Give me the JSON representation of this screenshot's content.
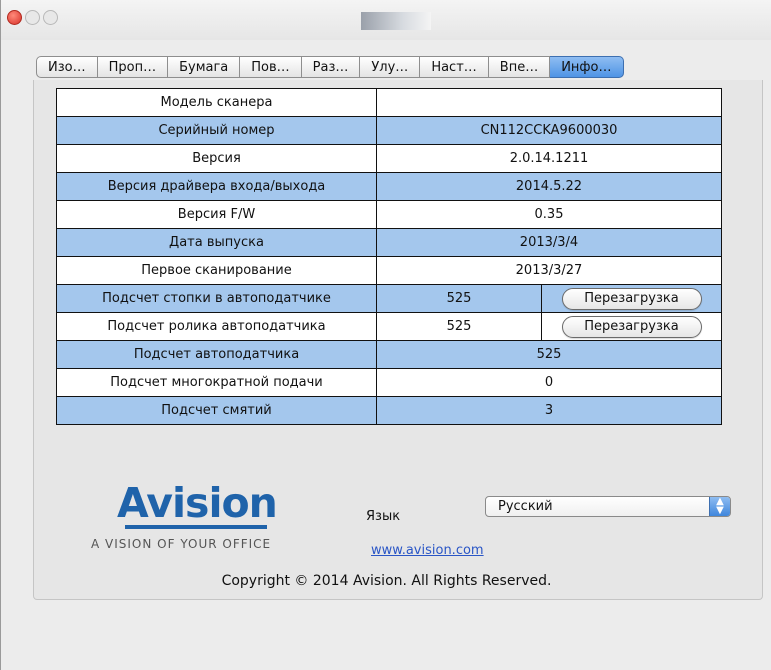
{
  "window": {
    "tabs": [
      "Изо…",
      "Проп…",
      "Бумага",
      "Пов…",
      "Раз…",
      "Улу…",
      "Наст…",
      "Впе…",
      "Инфо…"
    ],
    "active_tab": "Инфо…"
  },
  "info": {
    "rows": [
      {
        "label": "Модель сканера",
        "value": ""
      },
      {
        "label": "Серийный номер",
        "value": "CN112CCKA9600030"
      },
      {
        "label": "Версия",
        "value": "2.0.14.1211"
      },
      {
        "label": "Версия драйвера входа/выхода",
        "value": "2014.5.22"
      },
      {
        "label": "Версия F/W",
        "value": "0.35"
      },
      {
        "label": "Дата выпуска",
        "value": "2013/3/4"
      },
      {
        "label": "Первое сканирование",
        "value": "2013/3/27"
      }
    ],
    "counter_rows": [
      {
        "label": "Подсчет стопки в автоподатчике",
        "value": "525",
        "button": "Перезагрузка"
      },
      {
        "label": "Подсчет ролика автоподатчика",
        "value": "525",
        "button": "Перезагрузка"
      }
    ],
    "tail_rows": [
      {
        "label": "Подсчет автоподатчика",
        "value": "525"
      },
      {
        "label": "Подсчет многократной подачи",
        "value": "0"
      },
      {
        "label": "Подсчет смятий",
        "value": "3"
      }
    ]
  },
  "footer": {
    "logo_text": "Avision",
    "slogan": "A VISION OF YOUR OFFICE",
    "language_label": "Язык",
    "language_value": "Русский",
    "website": "www.avision.com",
    "copyright": "Copyright © 2014 Avision. All Rights Reserved."
  },
  "colors": {
    "row_blue": "#a4c7ed",
    "tab_active": "#4f94e5",
    "logo_blue": "#1f63aa",
    "link": "#2a56c6"
  }
}
